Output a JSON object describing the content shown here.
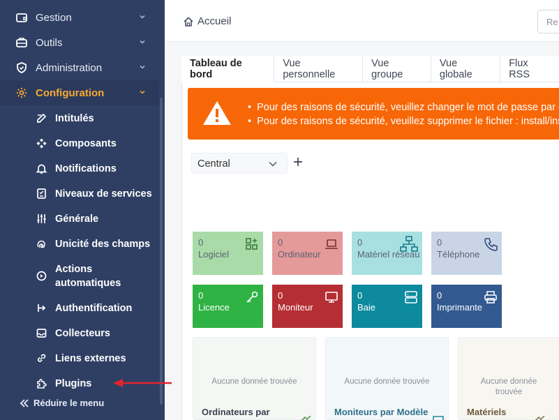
{
  "sidebar": {
    "menu": [
      {
        "label": "Gestion",
        "icon": "wallet-icon"
      },
      {
        "label": "Outils",
        "icon": "briefcase-icon"
      },
      {
        "label": "Administration",
        "icon": "shield-icon"
      },
      {
        "label": "Configuration",
        "icon": "gear-icon"
      }
    ],
    "submenu": [
      {
        "label": "Intitulés",
        "icon": "edit-icon"
      },
      {
        "label": "Composants",
        "icon": "components-icon"
      },
      {
        "label": "Notifications",
        "icon": "bell-icon"
      },
      {
        "label": "Niveaux de services",
        "icon": "checklist-icon"
      },
      {
        "label": "Générale",
        "icon": "sliders-icon"
      },
      {
        "label": "Unicité des champs",
        "icon": "fingerprint-icon"
      },
      {
        "label": "Actions automatiques",
        "icon": "gear-play-icon"
      },
      {
        "label": "Authentification",
        "icon": "login-icon"
      },
      {
        "label": "Collecteurs",
        "icon": "inbox-icon"
      },
      {
        "label": "Liens externes",
        "icon": "link-icon"
      },
      {
        "label": "Plugins",
        "icon": "puzzle-icon"
      }
    ],
    "reduce_label": "Réduire le menu"
  },
  "header": {
    "breadcrumb": "Accueil",
    "search_placeholder": "Re"
  },
  "tabs": [
    "Tableau de bord",
    "Vue personnelle",
    "Vue groupe",
    "Vue globale",
    "Flux RSS"
  ],
  "alert": {
    "lines": [
      "Pour des raisons de sécurité, veuillez changer le mot de passe par défaut",
      "Pour des raisons de sécurité, veuillez supprimer le fichier : install/install.php"
    ]
  },
  "dashboard_select": "Central",
  "cards": [
    {
      "count": "0",
      "label": "Logiciel",
      "icon": "apps-icon",
      "color": "#a8dba8"
    },
    {
      "count": "0",
      "label": "Ordinateur",
      "icon": "laptop-icon",
      "color": "#e59a9a"
    },
    {
      "count": "0",
      "label": "Matériel réseau",
      "icon": "network-icon",
      "color": "#a8e0e2"
    },
    {
      "count": "0",
      "label": "Téléphone",
      "icon": "phone-icon",
      "color": "#c9d5e6"
    },
    {
      "count": "0",
      "label": "Licence",
      "icon": "key-icon",
      "color": "#2fb344"
    },
    {
      "count": "0",
      "label": "Moniteur",
      "icon": "monitor-icon",
      "color": "#b52e33"
    },
    {
      "count": "0",
      "label": "Baie",
      "icon": "server-icon",
      "color": "#0d8a9e"
    },
    {
      "count": "0",
      "label": "Imprimante",
      "icon": "printer-icon",
      "color": "#325a91"
    }
  ],
  "widgets": [
    {
      "empty": "Aucune donnée trouvée",
      "title": "Ordinateurs par",
      "tint": "#f4f7f4"
    },
    {
      "empty": "Aucune donnée trouvée",
      "title": "Moniteurs par Modèle",
      "tint": "#f2f8f9"
    },
    {
      "empty": "Aucune donnée trouvée",
      "title": "Matériels",
      "tint": "#f8f6f1"
    }
  ]
}
